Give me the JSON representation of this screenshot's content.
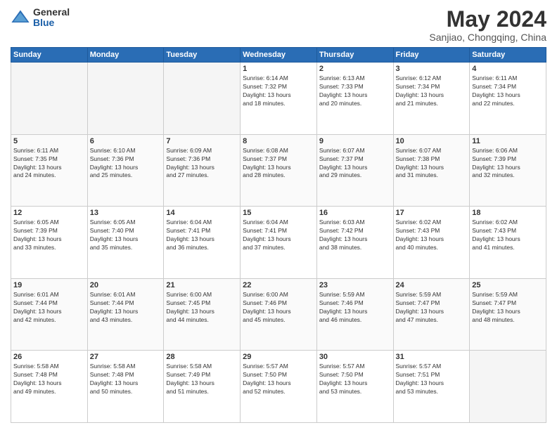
{
  "header": {
    "logo_general": "General",
    "logo_blue": "Blue",
    "title": "May 2024",
    "location": "Sanjiao, Chongqing, China"
  },
  "days_of_week": [
    "Sunday",
    "Monday",
    "Tuesday",
    "Wednesday",
    "Thursday",
    "Friday",
    "Saturday"
  ],
  "weeks": [
    [
      {
        "day": "",
        "info": ""
      },
      {
        "day": "",
        "info": ""
      },
      {
        "day": "",
        "info": ""
      },
      {
        "day": "1",
        "info": "Sunrise: 6:14 AM\nSunset: 7:32 PM\nDaylight: 13 hours\nand 18 minutes."
      },
      {
        "day": "2",
        "info": "Sunrise: 6:13 AM\nSunset: 7:33 PM\nDaylight: 13 hours\nand 20 minutes."
      },
      {
        "day": "3",
        "info": "Sunrise: 6:12 AM\nSunset: 7:34 PM\nDaylight: 13 hours\nand 21 minutes."
      },
      {
        "day": "4",
        "info": "Sunrise: 6:11 AM\nSunset: 7:34 PM\nDaylight: 13 hours\nand 22 minutes."
      }
    ],
    [
      {
        "day": "5",
        "info": "Sunrise: 6:11 AM\nSunset: 7:35 PM\nDaylight: 13 hours\nand 24 minutes."
      },
      {
        "day": "6",
        "info": "Sunrise: 6:10 AM\nSunset: 7:36 PM\nDaylight: 13 hours\nand 25 minutes."
      },
      {
        "day": "7",
        "info": "Sunrise: 6:09 AM\nSunset: 7:36 PM\nDaylight: 13 hours\nand 27 minutes."
      },
      {
        "day": "8",
        "info": "Sunrise: 6:08 AM\nSunset: 7:37 PM\nDaylight: 13 hours\nand 28 minutes."
      },
      {
        "day": "9",
        "info": "Sunrise: 6:07 AM\nSunset: 7:37 PM\nDaylight: 13 hours\nand 29 minutes."
      },
      {
        "day": "10",
        "info": "Sunrise: 6:07 AM\nSunset: 7:38 PM\nDaylight: 13 hours\nand 31 minutes."
      },
      {
        "day": "11",
        "info": "Sunrise: 6:06 AM\nSunset: 7:39 PM\nDaylight: 13 hours\nand 32 minutes."
      }
    ],
    [
      {
        "day": "12",
        "info": "Sunrise: 6:05 AM\nSunset: 7:39 PM\nDaylight: 13 hours\nand 33 minutes."
      },
      {
        "day": "13",
        "info": "Sunrise: 6:05 AM\nSunset: 7:40 PM\nDaylight: 13 hours\nand 35 minutes."
      },
      {
        "day": "14",
        "info": "Sunrise: 6:04 AM\nSunset: 7:41 PM\nDaylight: 13 hours\nand 36 minutes."
      },
      {
        "day": "15",
        "info": "Sunrise: 6:04 AM\nSunset: 7:41 PM\nDaylight: 13 hours\nand 37 minutes."
      },
      {
        "day": "16",
        "info": "Sunrise: 6:03 AM\nSunset: 7:42 PM\nDaylight: 13 hours\nand 38 minutes."
      },
      {
        "day": "17",
        "info": "Sunrise: 6:02 AM\nSunset: 7:43 PM\nDaylight: 13 hours\nand 40 minutes."
      },
      {
        "day": "18",
        "info": "Sunrise: 6:02 AM\nSunset: 7:43 PM\nDaylight: 13 hours\nand 41 minutes."
      }
    ],
    [
      {
        "day": "19",
        "info": "Sunrise: 6:01 AM\nSunset: 7:44 PM\nDaylight: 13 hours\nand 42 minutes."
      },
      {
        "day": "20",
        "info": "Sunrise: 6:01 AM\nSunset: 7:44 PM\nDaylight: 13 hours\nand 43 minutes."
      },
      {
        "day": "21",
        "info": "Sunrise: 6:00 AM\nSunset: 7:45 PM\nDaylight: 13 hours\nand 44 minutes."
      },
      {
        "day": "22",
        "info": "Sunrise: 6:00 AM\nSunset: 7:46 PM\nDaylight: 13 hours\nand 45 minutes."
      },
      {
        "day": "23",
        "info": "Sunrise: 5:59 AM\nSunset: 7:46 PM\nDaylight: 13 hours\nand 46 minutes."
      },
      {
        "day": "24",
        "info": "Sunrise: 5:59 AM\nSunset: 7:47 PM\nDaylight: 13 hours\nand 47 minutes."
      },
      {
        "day": "25",
        "info": "Sunrise: 5:59 AM\nSunset: 7:47 PM\nDaylight: 13 hours\nand 48 minutes."
      }
    ],
    [
      {
        "day": "26",
        "info": "Sunrise: 5:58 AM\nSunset: 7:48 PM\nDaylight: 13 hours\nand 49 minutes."
      },
      {
        "day": "27",
        "info": "Sunrise: 5:58 AM\nSunset: 7:48 PM\nDaylight: 13 hours\nand 50 minutes."
      },
      {
        "day": "28",
        "info": "Sunrise: 5:58 AM\nSunset: 7:49 PM\nDaylight: 13 hours\nand 51 minutes."
      },
      {
        "day": "29",
        "info": "Sunrise: 5:57 AM\nSunset: 7:50 PM\nDaylight: 13 hours\nand 52 minutes."
      },
      {
        "day": "30",
        "info": "Sunrise: 5:57 AM\nSunset: 7:50 PM\nDaylight: 13 hours\nand 53 minutes."
      },
      {
        "day": "31",
        "info": "Sunrise: 5:57 AM\nSunset: 7:51 PM\nDaylight: 13 hours\nand 53 minutes."
      },
      {
        "day": "",
        "info": ""
      }
    ]
  ]
}
